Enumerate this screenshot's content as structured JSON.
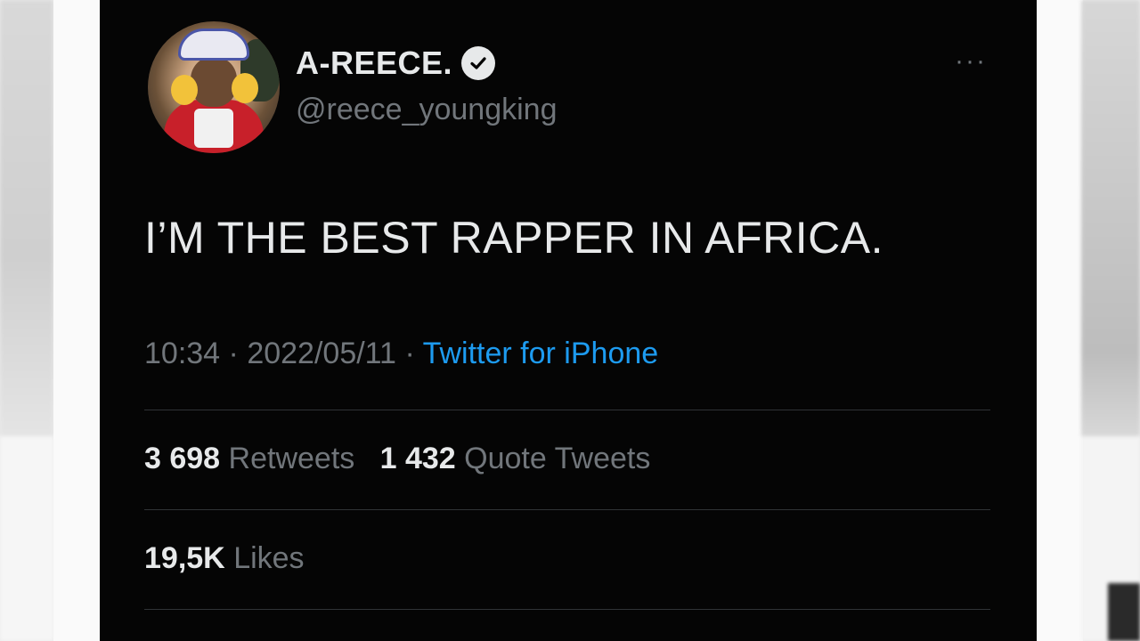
{
  "tweet": {
    "author": {
      "display_name": "A-REECE.",
      "verified_icon": "verified-badge-icon",
      "handle": "@reece_youngking"
    },
    "more_icon": "more-options-icon",
    "more_label": "···",
    "text": "I’M THE BEST RAPPER IN AFRICA.",
    "meta": {
      "time": "10:34",
      "separator": "·",
      "date": "2022/05/11",
      "source": "Twitter for iPhone"
    },
    "stats": {
      "retweets_count": "3 698",
      "retweets_label": "Retweets",
      "quotes_count": "1 432",
      "quotes_label": "Quote Tweets",
      "likes_count": "19,5K",
      "likes_label": "Likes"
    }
  },
  "colors": {
    "card_background": "#050505",
    "primary_text": "#e7e9ea",
    "secondary_text": "#71767b",
    "link": "#1d9bf0",
    "divider": "#2f3336"
  }
}
